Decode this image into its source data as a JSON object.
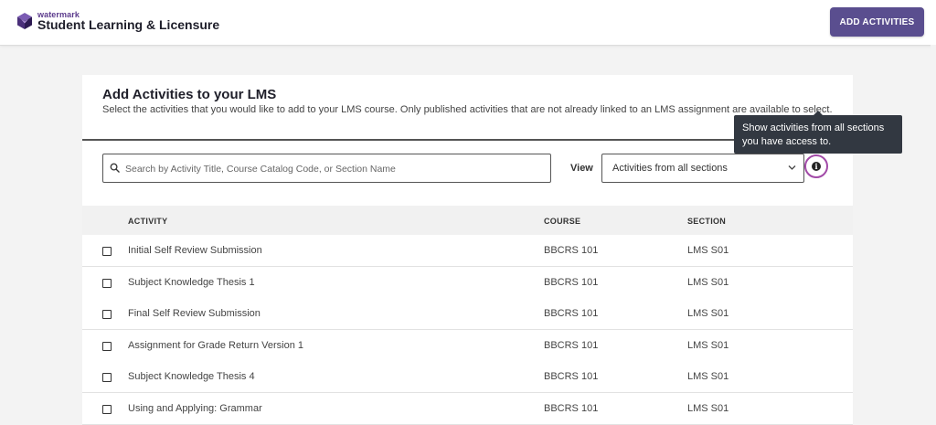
{
  "header": {
    "brand_top": "watermark",
    "brand_main": "Student Learning & Licensure",
    "add_button": "ADD ACTIVITIES"
  },
  "card": {
    "title": "Add Activities to your LMS",
    "description": "Select the activities that you would like to add to your LMS course. Only published activities that are not already linked to an LMS assignment are available to select."
  },
  "filters": {
    "search_placeholder": "Search by Activity Title, Course Catalog Code, or Section Name",
    "search_value": "",
    "view_label": "View",
    "view_selected": "Activities from all sections"
  },
  "tooltip": {
    "text": "Show activities from all sections you have access to."
  },
  "table": {
    "headers": {
      "activity": "ACTIVITY",
      "course": "COURSE",
      "section": "SECTION"
    },
    "rows": [
      {
        "activity": "Initial Self Review Submission",
        "course": "BBCRS 101",
        "section": "LMS S01",
        "checked": false
      },
      {
        "activity": "Subject Knowledge Thesis 1",
        "course": "BBCRS 101",
        "section": "LMS S01",
        "checked": false
      },
      {
        "activity": "Final Self Review Submission",
        "course": "BBCRS 101",
        "section": "LMS S01",
        "checked": false
      },
      {
        "activity": "Assignment for Grade Return Version 1",
        "course": "BBCRS 101",
        "section": "LMS S01",
        "checked": false
      },
      {
        "activity": "Subject Knowledge Thesis 4",
        "course": "BBCRS 101",
        "section": "LMS S01",
        "checked": false
      },
      {
        "activity": "Using and Applying: Grammar",
        "course": "BBCRS 101",
        "section": "LMS S01",
        "checked": false
      }
    ]
  },
  "colors": {
    "accent": "#5a4e8f",
    "focus_ring": "#a24ba8",
    "tooltip_bg": "#323841"
  }
}
